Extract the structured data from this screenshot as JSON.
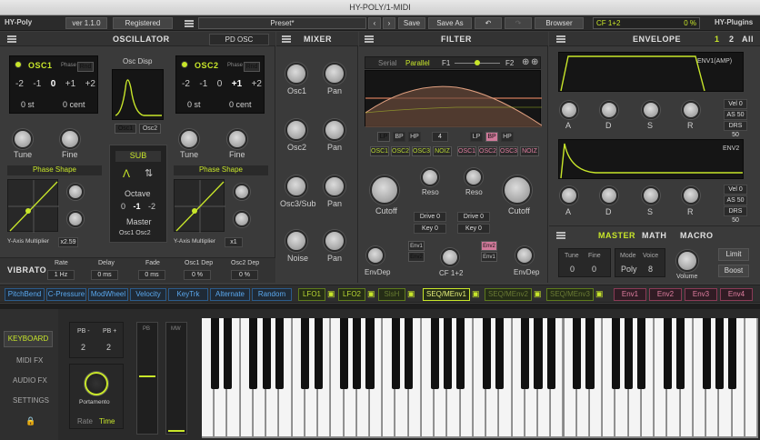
{
  "window": {
    "title": "HY-POLY/1-MIDI"
  },
  "toolbar": {
    "plugin": "HY-Poly",
    "version": "ver 1.1.0",
    "registered": "Registered",
    "preset": "Preset*",
    "save": "Save",
    "save_as": "Save As",
    "browser": "Browser",
    "cf_label": "CF 1+2",
    "cf_value": "0 %",
    "vendor": "HY-Plugins"
  },
  "osc": {
    "title": "OSCILLATOR",
    "mode": "PD OSC",
    "osc1": "OSC1",
    "osc2": "OSC2",
    "phase": "Phase",
    "rnd": "Rnd",
    "osc1_vals": [
      "-2",
      "-1",
      "0",
      "+1",
      "+2"
    ],
    "osc1_sel": "0",
    "osc2_vals": [
      "-2",
      "-1",
      "0",
      "+1",
      "+2"
    ],
    "osc2_sel": "+1",
    "st": "0 st",
    "cent": "0 cent",
    "tune": "Tune",
    "fine": "Fine",
    "phase_shape": "Phase Shape",
    "yaxis": "Y-Axis Multiplier",
    "y1": "x2.59",
    "y2": "x1",
    "disp": "Osc Disp",
    "disp_osc1": "Osc1",
    "disp_osc2": "Osc2",
    "sub": "SUB",
    "octave": "Octave",
    "oct_vals": [
      "0",
      "-1",
      "-2"
    ],
    "oct_sel": "-1",
    "master": "Master",
    "master_val": "Osc1 Osc2"
  },
  "vibrato": {
    "title": "VIBRATO",
    "cols": [
      {
        "l": "Rate",
        "v": "1 Hz"
      },
      {
        "l": "Delay",
        "v": "0 ms"
      },
      {
        "l": "Fade",
        "v": "0 ms"
      },
      {
        "l": "Osc1 Dep",
        "v": "0 %"
      },
      {
        "l": "Osc2 Dep",
        "v": "0 %"
      }
    ]
  },
  "mixer": {
    "title": "MIXER",
    "rows": [
      {
        "a": "Osc1",
        "b": "Pan"
      },
      {
        "a": "Osc2",
        "b": "Pan"
      },
      {
        "a": "Osc3/Sub",
        "b": "Pan"
      },
      {
        "a": "Noise",
        "b": "Pan"
      }
    ]
  },
  "filter": {
    "title": "FILTER",
    "serial": "Serial",
    "parallel": "Parallel",
    "f1": "F1",
    "f2": "F2",
    "f1_types": [
      "LP",
      "BP",
      "HP"
    ],
    "f2_types": [
      "LP",
      "BP",
      "HP"
    ],
    "slope": "4",
    "srcs": [
      "OSC1",
      "OSC2",
      "OSC3",
      "NOIZ"
    ],
    "cutoff": "Cutoff",
    "reso": "Reso",
    "drive": "Drive 0",
    "key": "Key 0",
    "envdep": "EnvDep",
    "env1": "Env1",
    "env2": "Env2",
    "envsel": "Env2",
    "cf": "CF 1+2"
  },
  "env": {
    "title": "ENVELOPE",
    "tabs": [
      "1",
      "2",
      "All"
    ],
    "env1": "ENV1(AMP)",
    "env2": "ENV2",
    "adsr": [
      "A",
      "D",
      "S",
      "R"
    ],
    "vel": "Vel 0",
    "as": "AS 50",
    "drs": "DRS 50"
  },
  "master": {
    "title": "MASTER",
    "tabs": [
      "MATH",
      "MACRO"
    ],
    "tune": "Tune",
    "fine": "Fine",
    "tune_v": "0",
    "fine_v": "0",
    "mode": "Mode",
    "voice": "Voice",
    "mode_v": "Poly",
    "voice_v": "8",
    "volume": "Volume",
    "limit": "Limit",
    "boost": "Boost"
  },
  "mods": {
    "blue": [
      "PitchBend",
      "C-Pressure",
      "ModWheel",
      "Velocity",
      "KeyTrk",
      "Alternate",
      "Random"
    ],
    "lfo": [
      "LFO1",
      "LFO2",
      "SlsH"
    ],
    "seq": [
      "SEQ/MEnv1",
      "SEQ/MEnv2",
      "SEQ/MEnv3"
    ],
    "env": [
      "Env1",
      "Env2",
      "Env3",
      "Env4"
    ]
  },
  "side": {
    "items": [
      "KEYBOARD",
      "MIDI FX",
      "AUDIO FX",
      "SETTINGS"
    ]
  },
  "perf": {
    "pbm": "PB -",
    "pbp": "PB +",
    "pbm_v": "2",
    "pbp_v": "2",
    "portamento": "Portamento",
    "rate": "Rate",
    "time": "Time",
    "pb": "PB",
    "mw": "MW"
  },
  "colors": {
    "accent": "#c8e62a",
    "blue": "#5aa8ee",
    "pink": "#e07ea0",
    "panel": "#3a3a3a"
  }
}
